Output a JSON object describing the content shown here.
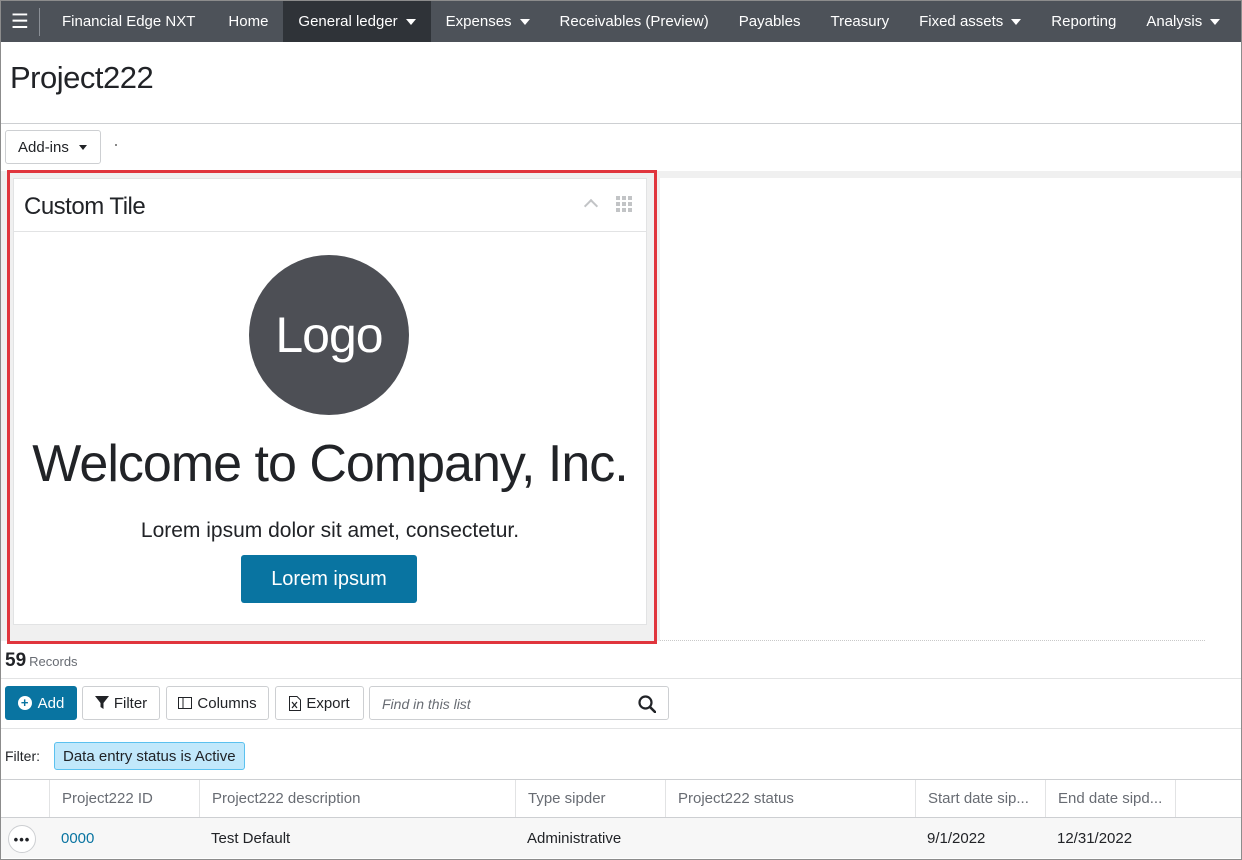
{
  "navbar": {
    "brand": "Financial Edge NXT",
    "items": [
      {
        "label": "Home",
        "dropdown": false
      },
      {
        "label": "General ledger",
        "dropdown": true,
        "active": true
      },
      {
        "label": "Expenses",
        "dropdown": true
      },
      {
        "label": "Receivables (Preview)",
        "dropdown": false
      },
      {
        "label": "Payables",
        "dropdown": false
      },
      {
        "label": "Treasury",
        "dropdown": false
      },
      {
        "label": "Fixed assets",
        "dropdown": true
      },
      {
        "label": "Reporting",
        "dropdown": false
      },
      {
        "label": "Analysis",
        "dropdown": true
      }
    ],
    "icon": "hamburger-menu-icon"
  },
  "page": {
    "title": "Project222",
    "addins_label": "Add-ins"
  },
  "tile": {
    "title": "Custom Tile",
    "logo_text": "Logo",
    "welcome": "Welcome to Company, Inc.",
    "text": "Lorem ipsum dolor sit amet, consectetur.",
    "button_label": "Lorem ipsum"
  },
  "list": {
    "record_count": "59",
    "record_label": "Records",
    "toolbar": {
      "add_label": "Add",
      "filter_label": "Filter",
      "columns_label": "Columns",
      "export_label": "Export",
      "search_placeholder": "Find in this list"
    },
    "filter": {
      "label": "Filter:",
      "chip": "Data entry status is Active"
    },
    "columns": [
      "Project222 ID",
      "Project222 description",
      "Type sipder",
      "Project222 status",
      "Start date sip...",
      "End date sipd..."
    ],
    "rows": [
      {
        "id": "0000",
        "description": "Test Default",
        "type": "Administrative",
        "status": "",
        "start": "9/1/2022",
        "end": "12/31/2022"
      }
    ]
  },
  "colors": {
    "navbar": "#4d5259",
    "primary": "#0974a1",
    "highlight": "#e0353d",
    "chip_bg": "#c1e8fb"
  }
}
